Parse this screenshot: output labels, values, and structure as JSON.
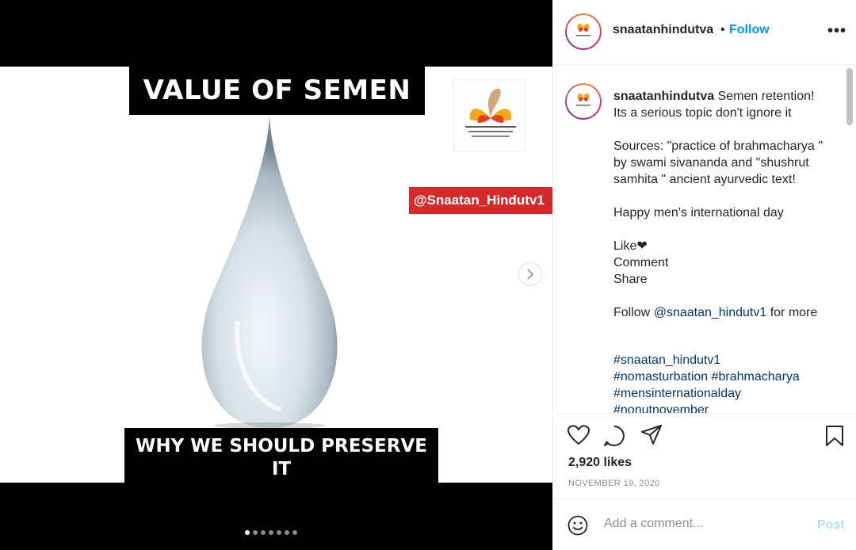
{
  "post_image": {
    "title": "VALUE OF SEMEN",
    "subtitle_line1": "WHY WE SHOULD PRESERVE",
    "subtitle_line2": "IT",
    "handle_tag": "@Snaatan_Hindutv1",
    "slide_count": 7,
    "active_slide": 1
  },
  "header": {
    "username": "snaatanhindutva",
    "separator": "•",
    "follow_label": "Follow",
    "more_label": "•••"
  },
  "caption": {
    "username": "snaatanhindutva",
    "line1": " Semen retention!",
    "line2": "Its a serious topic don't ignore it",
    "sources": "Sources: \"practice of brahmacharya \" by swami sivananda and \"shushrut samhita \" ancient ayurvedic text!",
    "greeting": "Happy men's international day",
    "like": "Like❤",
    "comment": "Comment",
    "share": "Share",
    "follow_prefix": "Follow ",
    "follow_link": "@snaatan_hindutv1",
    "follow_suffix": " for more",
    "hashtags": [
      "#snaatan_hindutv1",
      "#nomasturbation #brahmacharya",
      "#mensinternationalday",
      "#nonutnovember"
    ]
  },
  "stats": {
    "likes": "2,920 likes",
    "date": "NOVEMBER 19, 2020"
  },
  "comment_box": {
    "placeholder": "Add a comment...",
    "post_label": "Post"
  },
  "colors": {
    "accent": "#0095f6",
    "handle_tag_bg": "#d62a2a",
    "post_disabled": "#b2dffc"
  }
}
